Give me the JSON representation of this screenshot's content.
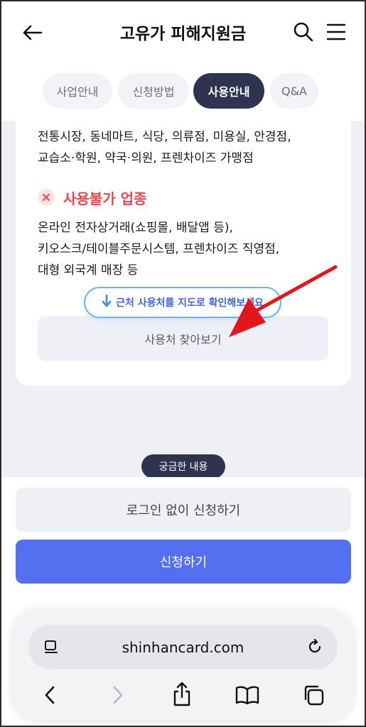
{
  "header": {
    "title": "고유가 피해지원금",
    "back_icon": "back-arrow-icon",
    "search_icon": "search-icon",
    "menu_icon": "hamburger-menu-icon"
  },
  "tabs": [
    {
      "label": "사업안내",
      "active": false
    },
    {
      "label": "신청방법",
      "active": false
    },
    {
      "label": "사용안내",
      "active": true
    },
    {
      "label": "Q&A",
      "active": false
    }
  ],
  "usage": {
    "available_lines": [
      "전통시장, 동네마트, 식당, 의류점, 미용실, 안경점,",
      "교습소·학원, 약국·의원, 프렌차이즈 가맹점"
    ],
    "unavailable_title": "사용불가 업종",
    "unavailable_lines": [
      "온라인 전자상거래(쇼핑몰, 배달앱 등),",
      "키오스크/테이블주문시스템, 프렌차이즈 직영점,",
      "대형 외국계 매장 등"
    ],
    "tooltip": "근처 사용처를 지도로 확인해보세요",
    "find_button": "사용처 찾아보기"
  },
  "faq_chip": "궁금한 내용",
  "actions": {
    "login_free": "로그인 없이 신청하기",
    "apply": "신청하기"
  },
  "browser": {
    "url": "shinhancard.com"
  },
  "colors": {
    "accent": "#5470f0",
    "dark_navy": "#2e3350",
    "danger": "#e5484d",
    "tooltip_border": "#63b6f5",
    "annotation_arrow": "#e3161b"
  }
}
